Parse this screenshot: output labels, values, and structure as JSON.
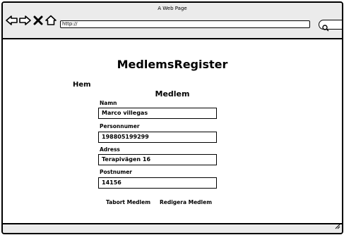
{
  "window": {
    "title": "A Web Page",
    "url": "http://"
  },
  "icons": {
    "back": "back-arrow-icon",
    "forward": "forward-arrow-icon",
    "close": "close-icon",
    "home": "home-icon",
    "search": "search-icon"
  },
  "page": {
    "title": "MedlemsRegister",
    "nav_home": "Hem",
    "section_title": "Medlem",
    "fields": {
      "name_label": "Namn",
      "name_value": "Marco villegas",
      "pnr_label": "Personnumer",
      "pnr_value": "198805199299",
      "address_label": "Adress",
      "address_value": "Terapivägen 16",
      "postal_label": "Postnumer",
      "postal_value": "14156"
    },
    "actions": {
      "remove": "Tabort Medlem",
      "edit": "Redigera Medlem"
    }
  }
}
